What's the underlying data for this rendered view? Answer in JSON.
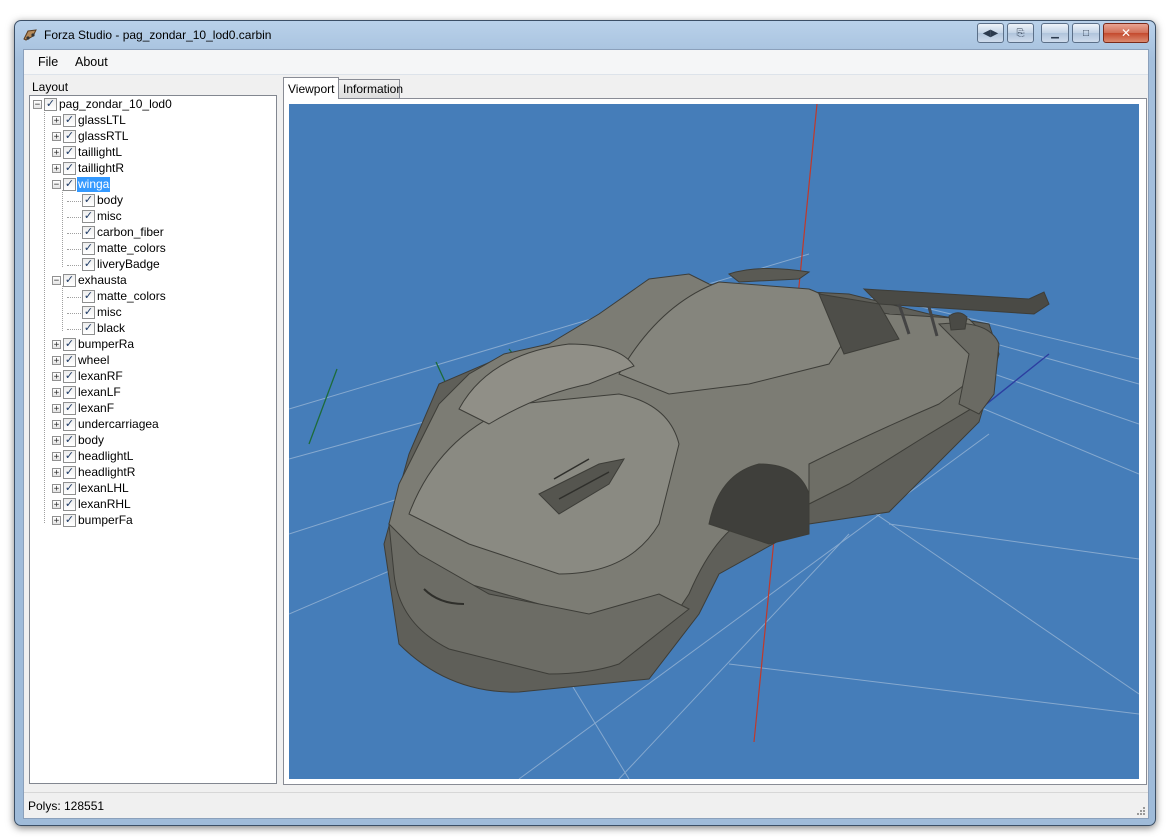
{
  "window": {
    "title": "Forza Studio - pag_zondar_10_lod0.carbin",
    "buttons": [
      "restore-arrows",
      "export",
      "minimize",
      "maximize",
      "close"
    ]
  },
  "menu": {
    "items": [
      {
        "label": "File"
      },
      {
        "label": "About"
      }
    ]
  },
  "layout_label": "Layout",
  "tree": {
    "root": "pag_zondar_10_lod0",
    "nodes": [
      {
        "label": "glassLTL",
        "expanded": false
      },
      {
        "label": "glassRTL",
        "expanded": false
      },
      {
        "label": "taillightL",
        "expanded": false
      },
      {
        "label": "taillightR",
        "expanded": false
      },
      {
        "label": "winga",
        "expanded": true,
        "selected": true,
        "children": [
          "body",
          "misc",
          "carbon_fiber",
          "matte_colors",
          "liveryBadge"
        ]
      },
      {
        "label": "exhausta",
        "expanded": true,
        "children": [
          "matte_colors",
          "misc",
          "black"
        ]
      },
      {
        "label": "bumperRa",
        "expanded": false
      },
      {
        "label": "wheel",
        "expanded": false
      },
      {
        "label": "lexanRF",
        "expanded": false
      },
      {
        "label": "lexanLF",
        "expanded": false
      },
      {
        "label": "lexanF",
        "expanded": false
      },
      {
        "label": "undercarriagea",
        "expanded": false
      },
      {
        "label": "body",
        "expanded": false
      },
      {
        "label": "headlightL",
        "expanded": false
      },
      {
        "label": "headlightR",
        "expanded": false
      },
      {
        "label": "lexanLHL",
        "expanded": false
      },
      {
        "label": "lexanRHL",
        "expanded": false
      },
      {
        "label": "bumperFa",
        "expanded": false
      }
    ]
  },
  "tabs": [
    {
      "label": "Viewport",
      "active": true
    },
    {
      "label": "Information",
      "active": false
    }
  ],
  "viewport": {
    "background": "#457db9",
    "model_color": "#7a7a72"
  },
  "status": {
    "text": "Polys: 128551"
  },
  "colors": {
    "selection": "#3399ff",
    "titlebar": "#b9d1ea",
    "close_button": "#c44a2e"
  }
}
